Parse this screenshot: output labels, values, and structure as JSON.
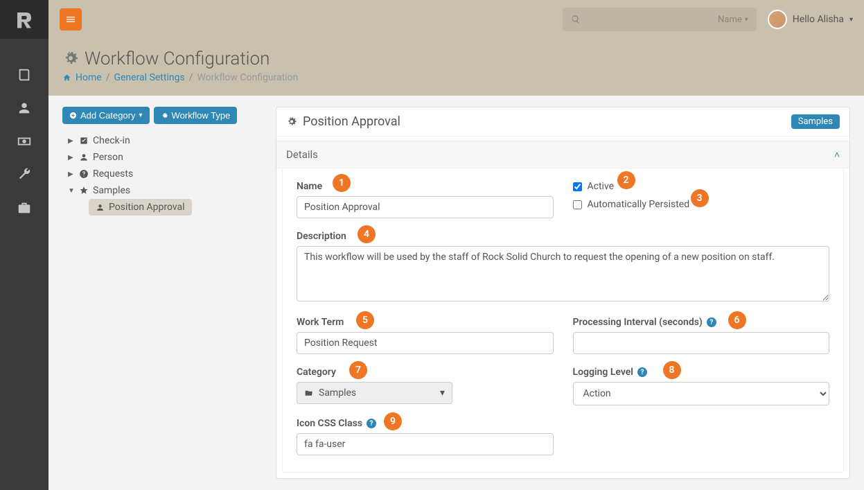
{
  "topbar": {
    "search_placeholder": "",
    "search_scope": "Name",
    "user_greeting": "Hello Alisha"
  },
  "page": {
    "title": "Workflow Configuration",
    "breadcrumb": {
      "home": "Home",
      "mid": "General Settings",
      "current": "Workflow Configuration"
    }
  },
  "leftcol": {
    "add_category": "Add Category",
    "workflow_type": "Workflow Type"
  },
  "tree": {
    "items": [
      {
        "label": "Check-in"
      },
      {
        "label": "Person"
      },
      {
        "label": "Requests"
      },
      {
        "label": "Samples"
      }
    ],
    "leaf": "Position Approval"
  },
  "panel": {
    "title": "Position Approval",
    "samples_btn": "Samples",
    "section": "Details"
  },
  "form": {
    "name_label": "Name",
    "name_value": "Position Approval",
    "active_label": "Active",
    "active_checked": true,
    "auto_persist_label": "Automatically Persisted",
    "auto_persist_checked": false,
    "description_label": "Description",
    "description_value": "This workflow will be used by the staff of Rock Solid Church to request the opening of a new position on staff.",
    "work_term_label": "Work Term",
    "work_term_value": "Position Request",
    "processing_label": "Processing Interval (seconds)",
    "processing_value": "",
    "category_label": "Category",
    "category_value": "Samples",
    "logging_label": "Logging Level",
    "logging_value": "Action",
    "icon_label": "Icon CSS Class",
    "icon_value": "fa fa-user"
  },
  "callouts": [
    "1",
    "2",
    "3",
    "4",
    "5",
    "6",
    "7",
    "8",
    "9"
  ]
}
